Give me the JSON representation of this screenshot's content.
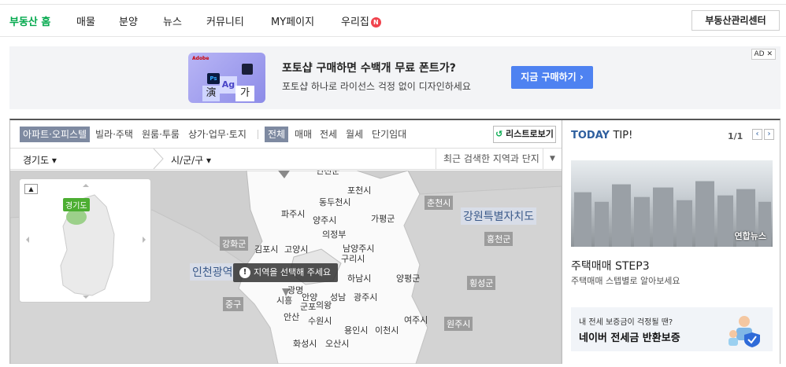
{
  "gnb": {
    "items": [
      "부동산 홈",
      "매물",
      "분양",
      "뉴스",
      "커뮤니티",
      "MY페이지",
      "우리집"
    ],
    "badge": "N",
    "center_button": "부동산관리센터"
  },
  "ad": {
    "title": "포토샵 구매하면 수백개 무료 폰트가?",
    "desc": "포토샵 하나로 라이선스 걱정 없이 디자인하세요",
    "cta": "지금 구매하기 ›",
    "badge": "AD ✕",
    "thumb_text": {
      "brand": "Adobe",
      "ps": "Ps",
      "ag": "Ag",
      "k1": "演",
      "k2": "가"
    }
  },
  "filter": {
    "types": [
      "아파트·오피스텔",
      "빌라·주택",
      "원룸·투룸",
      "상가·업무·토지"
    ],
    "deals": [
      "전체",
      "매매",
      "전세",
      "월세",
      "단기임대"
    ],
    "list_button": "리스트로보기"
  },
  "region": {
    "province": "경기도 ▾",
    "city": "시/군/구 ▾",
    "recent": "최근 검색한 지역과 단지"
  },
  "map": {
    "mini_tag": "경기도",
    "toast": "지역을 선택해 주세요",
    "labels": {
      "pocheon": "포천시",
      "dongducheon": "동두천시",
      "paju": "파주시",
      "yangju": "양주시",
      "gapyeong": "가평군",
      "uijeongbu": "의정부",
      "gimpo": "김포시",
      "goyang": "고양시",
      "namyangju": "남양주시",
      "guri": "구리시",
      "hanam": "하남시",
      "yangpyeong": "양평군",
      "gwangmyeong": "광명",
      "anyang": "안양",
      "gunpo": "군포",
      "uiwang": "의왕",
      "seongnam": "성남",
      "gwangju": "광주시",
      "siheung": "시흥",
      "ansan": "안산",
      "suwon": "수원시",
      "yongin": "용인시",
      "icheon": "이천시",
      "yeoju": "여주시",
      "hwaseong": "화성시",
      "osan": "오산시",
      "yeoncheon": "연천군",
      "chuncheon": "춘천시",
      "gangwon": "강원특별자치도",
      "hongcheon": "홍천군",
      "hoengseong": "횡성군",
      "wonju": "원주시",
      "ganghwa": "강화군",
      "incheon": "인천광역",
      "junggu": "중구"
    }
  },
  "tip": {
    "title_a": "TODAY",
    "title_b": "TIP!",
    "page": "1/1",
    "photo_watermark": "연합뉴스",
    "headline": "주택매매 STEP3",
    "sub": "주택매매 스텝별로 알아보세요",
    "promo_small": "내 전세 보증금이 걱정될 땐?",
    "promo_big": "네이버 전세금 반환보증"
  },
  "colors": {
    "brand_green": "#03a94d",
    "cta_blue": "#4e82f1",
    "tip_blue": "#2e5f9f"
  }
}
